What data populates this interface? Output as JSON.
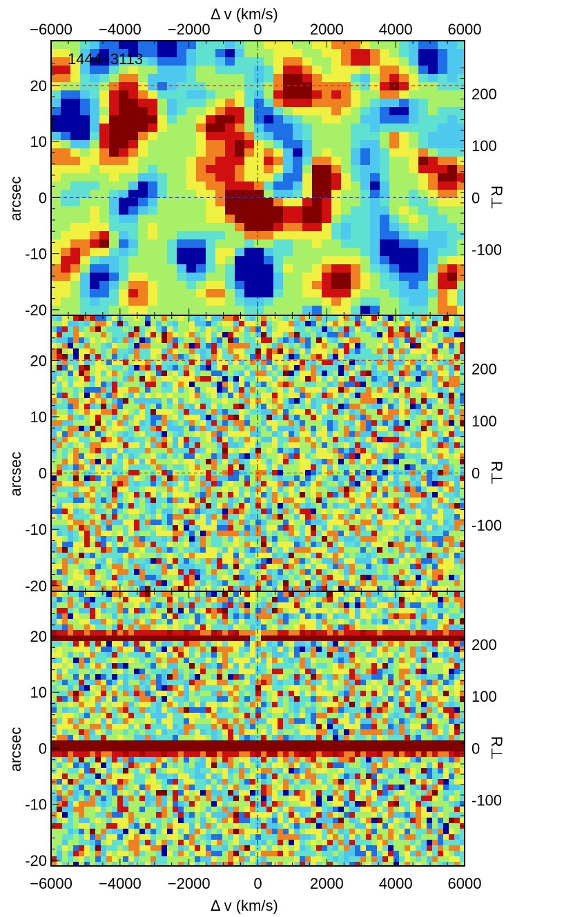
{
  "chart_data": [
    {
      "type": "heatmap",
      "panel": "top",
      "variant": "smoothed",
      "annotation": "1444+3113",
      "xlabel": "Δ v      (km/s)",
      "ylabel": "arcsec",
      "y2label": "R⊥",
      "xlim": [
        -6000,
        6000
      ],
      "ylim": [
        -21,
        28
      ],
      "xticks": [
        -6000,
        -4000,
        -2000,
        0,
        2000,
        4000,
        6000
      ],
      "yticks": [
        -20,
        -10,
        0,
        10,
        20
      ],
      "y2ticks": [
        -100,
        0,
        100,
        200
      ],
      "reference_lines": [
        {
          "axis": "x",
          "value": 0,
          "color": "#000000"
        },
        {
          "axis": "y",
          "value": 20,
          "color": "#d62728"
        },
        {
          "axis": "y",
          "value": 0,
          "color": "#1f3fbf"
        }
      ],
      "bright_bands_arcsec": [],
      "colormap": [
        "#0000a0",
        "#1f6fe8",
        "#4fc8f0",
        "#5fe0d0",
        "#a8f068",
        "#f0f040",
        "#f08020",
        "#d01010",
        "#800000"
      ]
    },
    {
      "type": "heatmap",
      "panel": "middle",
      "variant": "noise",
      "ylabel": "arcsec",
      "y2label": "R⊥",
      "xlim": [
        -6000,
        6000
      ],
      "ylim": [
        -21,
        28
      ],
      "yticks": [
        -20,
        -10,
        0,
        10,
        20
      ],
      "y2ticks": [
        -100,
        0,
        100,
        200
      ],
      "reference_lines": [
        {
          "axis": "x",
          "value": 0,
          "color": "#000000"
        },
        {
          "axis": "y",
          "value": 20,
          "color": "#d62728"
        },
        {
          "axis": "y",
          "value": 0,
          "color": "#1f3fbf"
        }
      ],
      "bright_bands_arcsec": []
    },
    {
      "type": "heatmap",
      "panel": "bottom",
      "variant": "with-quasar-traces",
      "xlabel": "Δ v      (km/s)",
      "ylabel": "arcsec",
      "y2label": "R⊥",
      "xlim": [
        -6000,
        6000
      ],
      "ylim": [
        -21,
        28
      ],
      "xticks": [
        -6000,
        -4000,
        -2000,
        0,
        2000,
        4000,
        6000
      ],
      "yticks": [
        -20,
        -10,
        0,
        10,
        20
      ],
      "y2ticks": [
        -100,
        0,
        100,
        200
      ],
      "reference_lines": [
        {
          "axis": "x",
          "value": 0,
          "color": "#000000"
        }
      ],
      "bright_bands_arcsec": [
        {
          "center": 20,
          "halfwidth": 0.6,
          "gap_kms": [
            -250,
            100
          ]
        },
        {
          "center": 0.3,
          "halfwidth": 1.1,
          "gap_kms": null
        }
      ]
    }
  ]
}
